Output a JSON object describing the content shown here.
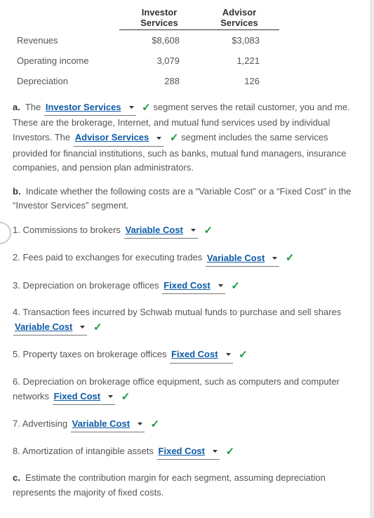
{
  "table": {
    "headers": {
      "col1": "Investor",
      "col1b": "Services",
      "col2": "Advisor",
      "col2b": "Services"
    },
    "rows": [
      {
        "label": "Revenues",
        "c1": "$8,608",
        "c2": "$3,083"
      },
      {
        "label": "Operating income",
        "c1": "3,079",
        "c2": "1,221"
      },
      {
        "label": "Depreciation",
        "c1": "288",
        "c2": "126"
      }
    ]
  },
  "a": {
    "label": "a.",
    "t1": "The ",
    "dd1": "Investor Services",
    "t2": " segment serves the retail customer, you and me. These are the brokerage, Internet, and mutual fund services used by individual Investors. The ",
    "dd2": "Advisor Services",
    "t3": " segment includes the same services provided for financial institutions, such as banks, mutual fund managers, insurance companies, and pension plan administrators."
  },
  "b": {
    "label": "b.",
    "intro": "Indicate whether the following costs are a “Variable Cost” or a “Fixed Cost” in the “Investor Services” segment.",
    "items": [
      {
        "n": "1.",
        "text": "Commissions to brokers ",
        "ans": "Variable Cost"
      },
      {
        "n": "2.",
        "text": "Fees paid to exchanges for executing trades ",
        "ans": "Variable Cost"
      },
      {
        "n": "3.",
        "text": "Depreciation on brokerage offices ",
        "ans": "Fixed Cost"
      },
      {
        "n": "4.",
        "text": "Transaction fees incurred by Schwab mutual funds to purchase and sell shares ",
        "ans": "Variable Cost"
      },
      {
        "n": "5.",
        "text": "Property taxes on brokerage offices ",
        "ans": "Fixed Cost"
      },
      {
        "n": "6.",
        "text": "Depreciation on brokerage office equipment, such as computers and computer networks ",
        "ans": "Fixed Cost"
      },
      {
        "n": "7.",
        "text": "Advertising ",
        "ans": "Variable Cost"
      },
      {
        "n": "8.",
        "text": "Amortization of intangible assets ",
        "ans": "Fixed Cost"
      }
    ]
  },
  "c": {
    "label": "c.",
    "text": "Estimate the contribution margin for each segment, assuming depreciation represents the majority of fixed costs."
  },
  "checkmark": "✓"
}
